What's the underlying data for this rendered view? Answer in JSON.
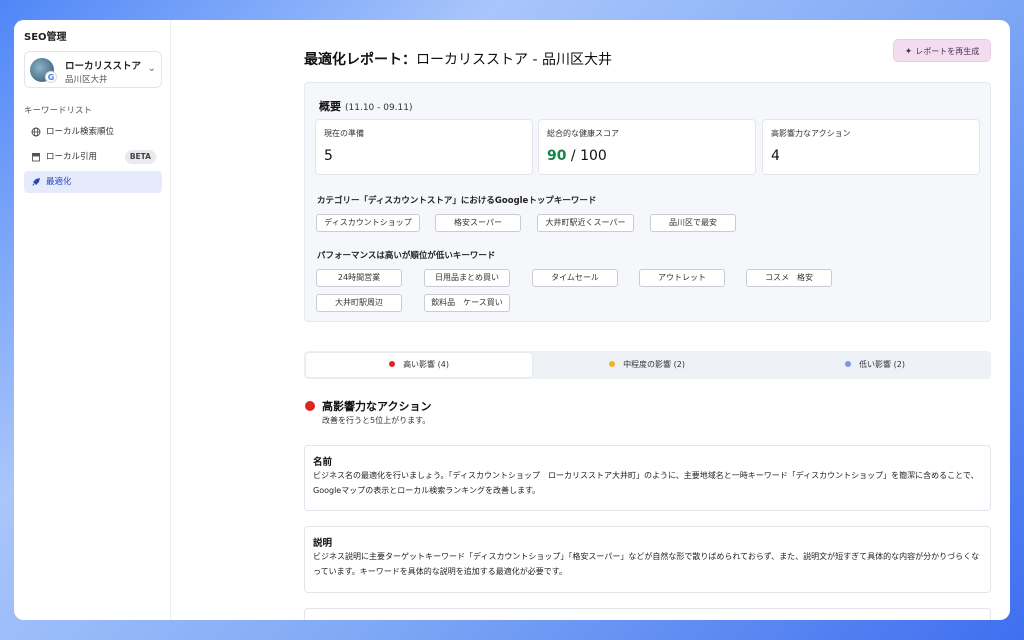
{
  "sidebar": {
    "title": "SEO管理",
    "profile": {
      "name": "ローカリスストア",
      "location": "品川区大井",
      "badge_letter": "G"
    },
    "section_label": "キーワードリスト",
    "items": [
      {
        "label": "ローカル検索順位",
        "icon": "globe-icon"
      },
      {
        "label": "ローカル引用",
        "icon": "store-icon",
        "badge": "BETA"
      },
      {
        "label": "最適化",
        "icon": "rocket-icon",
        "active": true
      }
    ]
  },
  "header": {
    "title_bold": "最適化レポート：",
    "title_rest": "ローカリスストア - 品川区大井",
    "regenerate_label": "レポートを再生成"
  },
  "overview": {
    "title": "概要",
    "range": "(11.10 - 09.11)",
    "stats": [
      {
        "label": "現在の準備",
        "value": "5"
      },
      {
        "label": "総合的な健康スコア",
        "score": "90",
        "max": " / 100"
      },
      {
        "label": "高影響力なアクション",
        "value": "4"
      }
    ],
    "top_keywords_heading": "カテゴリー「ディスカウントストア」におけるGoogleトップキーワード",
    "top_keywords": [
      "ディスカウントショップ",
      "格安スーパー",
      "大井町駅近くスーパー",
      "品川区で最安"
    ],
    "low_rank_heading": "パフォーマンスは高いが順位が低いキーワード",
    "low_rank_keywords": [
      "24時間営業",
      "日用品まとめ買い",
      "タイムセール",
      "アウトレット",
      "コスメ　格安",
      "大井町駅周辺",
      "飲料品　ケース買い"
    ]
  },
  "tabs": [
    {
      "label": "高い影響 (4)",
      "color": "#e02424"
    },
    {
      "label": "中程度の影響 (2)",
      "color": "#f0b429"
    },
    {
      "label": "低い影響 (2)",
      "color": "#7f96e8"
    }
  ],
  "actions": {
    "title": "高影響力なアクション",
    "subtitle": "改善を行うと5位上がります。",
    "cards": [
      {
        "title": "名前",
        "body": "ビジネス名の最適化を行いましょう。「ディスカウントショップ　ローカリスストア大井町」のように、主要地域名と一時キーワード「ディスカウントショップ」を簡潔に含めることで、Googleマップの表示とローカル検索ランキングを改善します。"
      },
      {
        "title": "説明",
        "body": "ビジネス説明に主要ターゲットキーワード「ディスカウントショップ」「格安スーパー」などが自然な形で散りばめられておらず、また、説明文が短すぎて具体的な内容が分かりづらくなっています。キーワードを具体的な説明を追加する最適化が必要です。"
      }
    ]
  },
  "colors": {
    "accent": "#2b45c9",
    "score_green": "#16834a",
    "regen_bg": "#f4dcf0"
  }
}
